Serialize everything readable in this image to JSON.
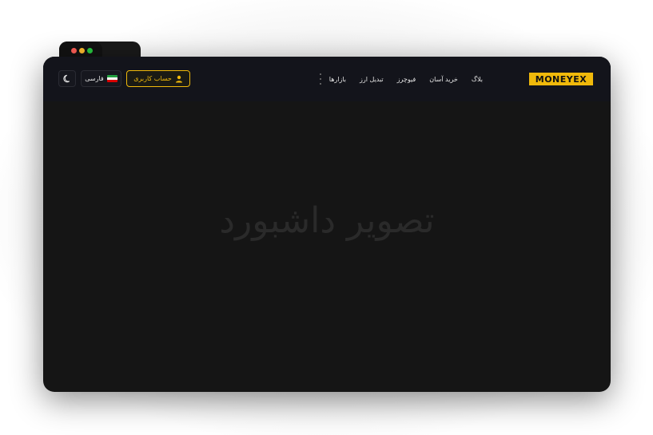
{
  "window": {
    "traffic_lights": [
      "#ff5f57",
      "#febc2e",
      "#28c840"
    ]
  },
  "navbar": {
    "logo_text": "MONEYEX",
    "links": [
      "بازارها",
      "تبدیل ارز",
      "فیوچرز",
      "خرید آسان",
      "بلاگ"
    ],
    "account_button": "حساب کاربری",
    "language_button": "فارسی",
    "theme_icon": "moon-icon",
    "more_icon": "kebab-menu-icon",
    "accent_color": "#f0b90b"
  },
  "main": {
    "placeholder_text": "تصویر داشبورد"
  }
}
